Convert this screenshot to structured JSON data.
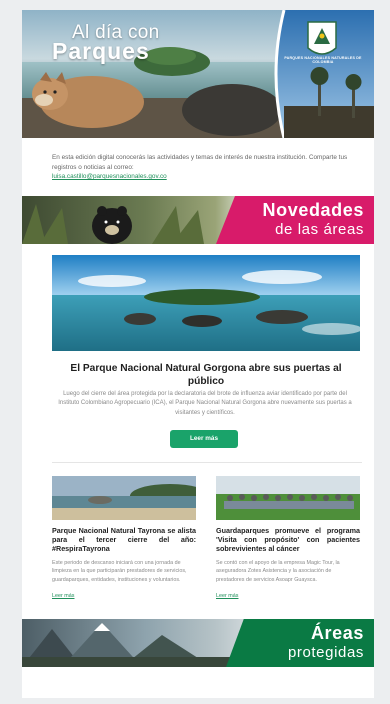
{
  "hero": {
    "title_top": "Al día con",
    "title_main": "Parques",
    "logo_text": "PARQUES NACIONALES NATURALES DE COLOMBIA"
  },
  "intro": {
    "text": "En esta edición digital conocerás las actividades y temas de interés de nuestra institución. Comparte tus registros o noticias al correo:",
    "email": "luisa.castillo@parquesnacionales.gov.co"
  },
  "banner_novedades": {
    "line1": "Novedades",
    "line2": "de las áreas"
  },
  "featured": {
    "title": "El Parque Nacional Natural Gorgona abre sus puertas al público",
    "text": "Luego del cierre del área protegida por la declaratoria del brote de influenza aviar identificado por parte del Instituto Colombiano Agropecuario (ICA), el Parque Nacional Natural Gorgona abre nuevamente sus puertas a visitantes y científicos.",
    "button": "Leer más"
  },
  "col_left": {
    "title": "Parque Nacional Natural Tayrona se alista para el tercer cierre del año: #RespiraTayrona",
    "text": "Este periodo de descanso iniciará con una jornada de limpieza en la que participarán prestadores de servicios, guardaparques, entidades, instituciones y voluntarios.",
    "link": "Leer más"
  },
  "col_right": {
    "title": "Guardaparques promueve el programa 'Visita con propósito' con pacientes sobrevivientes al cáncer",
    "text": "Se contó con el apoyo de la empresa Magic Tour, la aseguradora Zotes Asistencia y la asociación de prestadores de servicios Asoapr Guaysca.",
    "link": "Leer más"
  },
  "banner_areas": {
    "line1": "Áreas",
    "line2": "protegidas"
  },
  "colors": {
    "pink": "#d81b6a",
    "green": "#0a7a44",
    "button": "#1aa36a"
  }
}
